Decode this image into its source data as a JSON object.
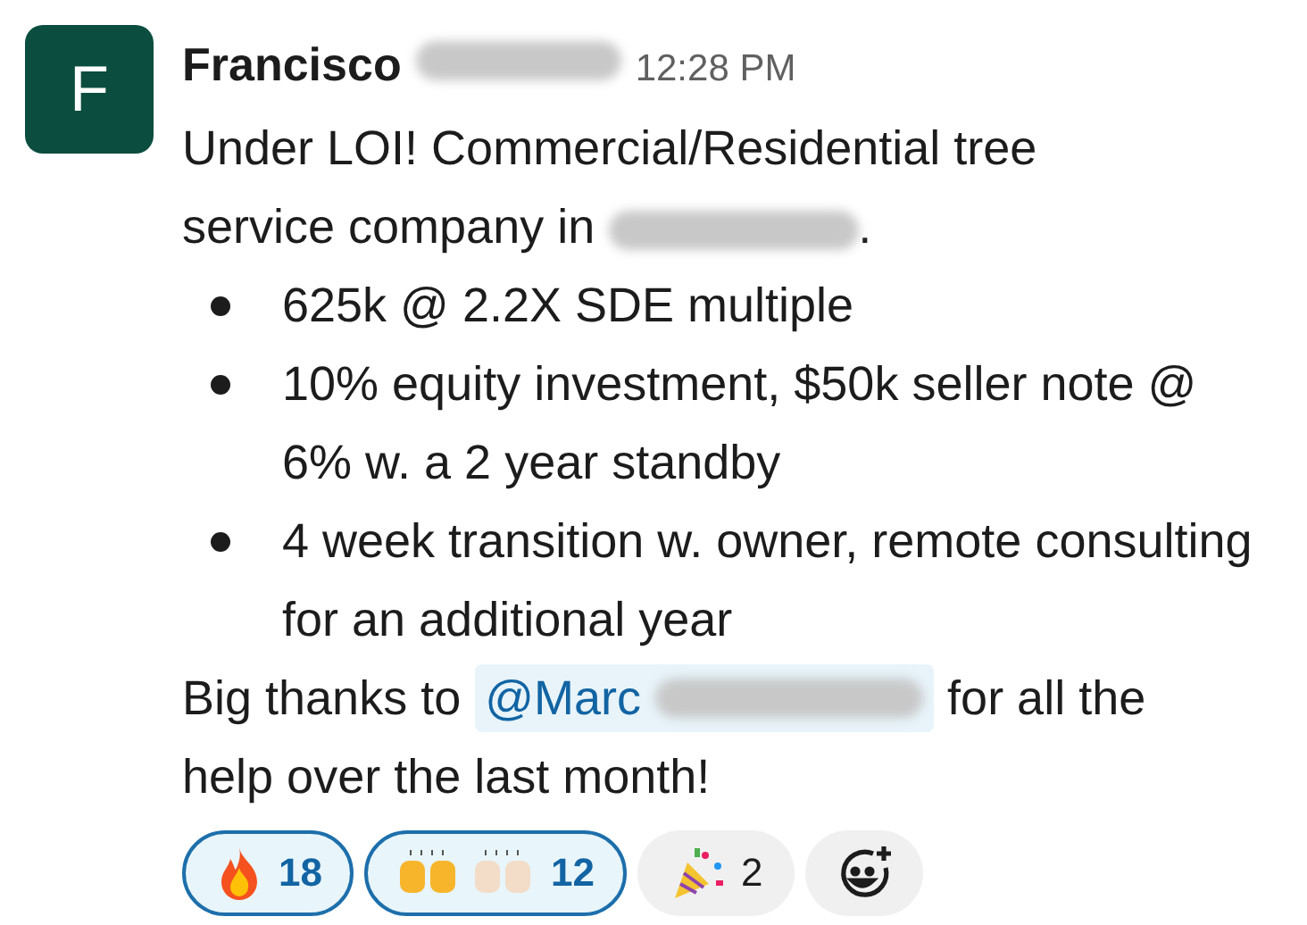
{
  "message": {
    "avatar_letter": "F",
    "author": "Francisco",
    "time": "12:28 PM",
    "intro_lines": [
      "Under LOI! Commercial/Residential tree",
      "service company in"
    ],
    "intro_end": ".",
    "bullets": [
      "625k @ 2.2X SDE multiple",
      "10% equity investment, $50k seller note @ 6% w. a 2 year standby",
      "4 week transition w. owner, remote consulting for an additional year"
    ],
    "thanks_before": "Big thanks to",
    "mention": "@Marc",
    "thanks_after": "for all the",
    "thanks_last_line": "help over the last month!"
  },
  "reactions": [
    {
      "kind": "fire",
      "count": "18",
      "selected": true
    },
    {
      "kind": "raised-hands",
      "count": "12",
      "selected": true
    },
    {
      "kind": "party",
      "count": "2",
      "selected": false
    }
  ]
}
